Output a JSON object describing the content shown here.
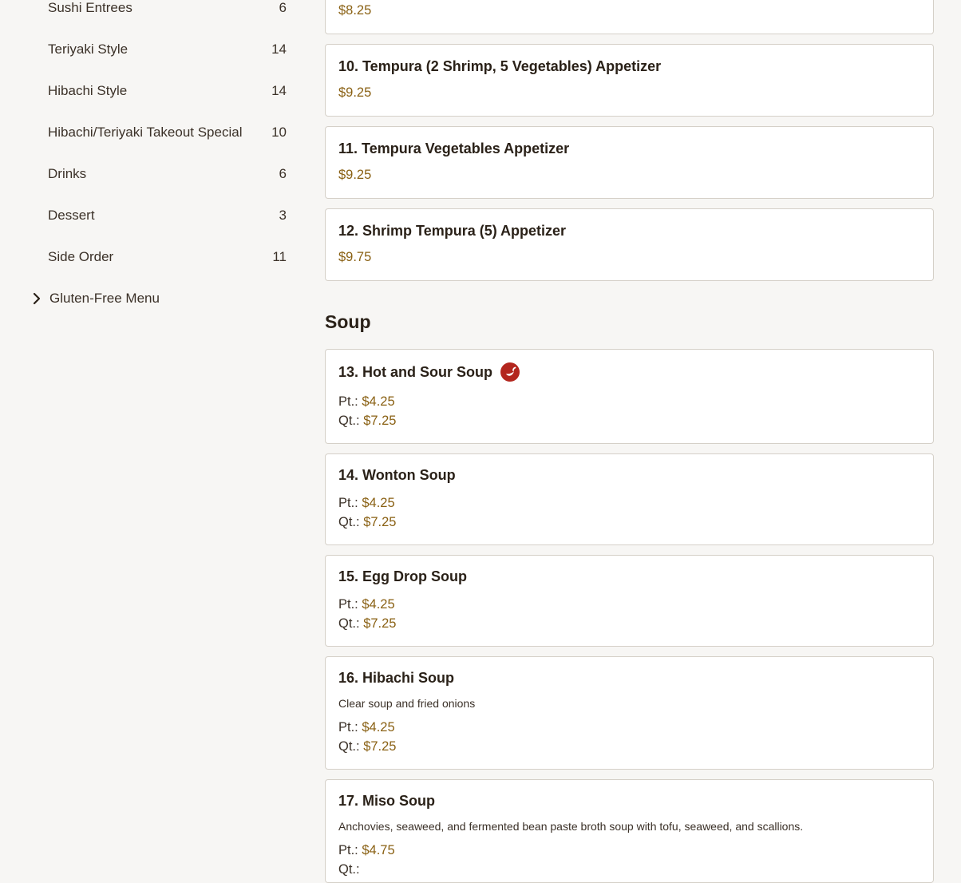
{
  "sidebar": {
    "categories": [
      {
        "label": "Sushi Entrees",
        "count": "6"
      },
      {
        "label": "Teriyaki Style",
        "count": "14"
      },
      {
        "label": "Hibachi Style",
        "count": "14"
      },
      {
        "label": "Hibachi/Teriyaki Takeout Special",
        "count": "10"
      },
      {
        "label": "Drinks",
        "count": "6"
      },
      {
        "label": "Dessert",
        "count": "3"
      },
      {
        "label": "Side Order",
        "count": "11"
      }
    ],
    "group": {
      "label": "Gluten-Free Menu"
    }
  },
  "menu": {
    "top_partial": {
      "price": "$8.25"
    },
    "appetizers": [
      {
        "name": "10. Tempura (2 Shrimp, 5 Vegetables) Appetizer",
        "price": "$9.25"
      },
      {
        "name": "11. Tempura Vegetables Appetizer",
        "price": "$9.25"
      },
      {
        "name": "12. Shrimp Tempura (5) Appetizer",
        "price": "$9.75"
      }
    ],
    "soup_section": {
      "title": "Soup",
      "items": [
        {
          "name": "13. Hot and Sour Soup",
          "spicy_icon": "chili-pepper-icon",
          "pt_label": "Pt.:",
          "pt_price": "$4.25",
          "qt_label": "Qt.:",
          "qt_price": "$7.25"
        },
        {
          "name": "14. Wonton Soup",
          "pt_label": "Pt.:",
          "pt_price": "$4.25",
          "qt_label": "Qt.:",
          "qt_price": "$7.25"
        },
        {
          "name": "15. Egg Drop Soup",
          "pt_label": "Pt.:",
          "pt_price": "$4.25",
          "qt_label": "Qt.:",
          "qt_price": "$7.25"
        },
        {
          "name": "16. Hibachi Soup",
          "description": "Clear soup and fried onions",
          "pt_label": "Pt.:",
          "pt_price": "$4.25",
          "qt_label": "Qt.:",
          "qt_price": "$7.25"
        },
        {
          "name": "17. Miso Soup",
          "description": "Anchovies, seaweed, and fermented bean paste broth soup with tofu, seaweed, and scallions.",
          "pt_label": "Pt.:",
          "pt_price": "$4.75",
          "qt_label": "Qt.:"
        }
      ]
    }
  },
  "colors": {
    "background": "#f7f6f4",
    "price": "#8a6114",
    "spicy": "#b3261e"
  }
}
